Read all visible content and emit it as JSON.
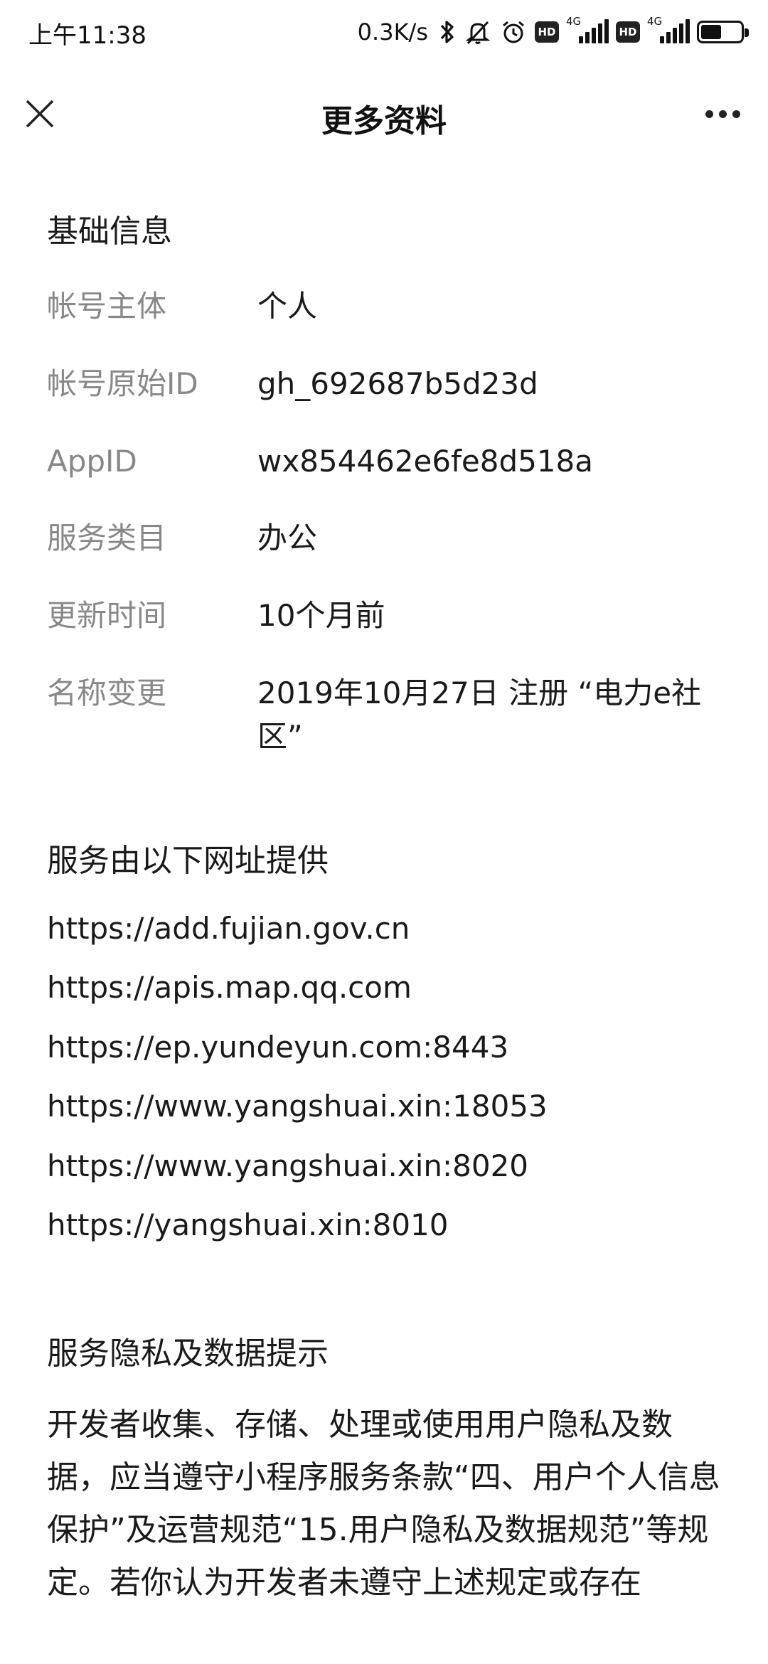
{
  "status_bar": {
    "time": "上午11:38",
    "network_speed": "0.3K/s",
    "hd_badge_1": "HD",
    "hd_badge_2": "HD",
    "signal_1_tag": "4G",
    "signal_2_tag": "4G",
    "icons": [
      "bluetooth-icon",
      "mute-icon",
      "alarm-icon",
      "signal-icon",
      "battery-icon"
    ]
  },
  "nav": {
    "title": "更多资料",
    "close_icon": "close-icon",
    "more_icon": "more-icon"
  },
  "basic_info": {
    "title": "基础信息",
    "rows": [
      {
        "label": "帐号主体",
        "value": "个人"
      },
      {
        "label": "帐号原始ID",
        "value": "gh_692687b5d23d"
      },
      {
        "label": "AppID",
        "value": "wx854462e6fe8d518a"
      },
      {
        "label": "服务类目",
        "value": "办公"
      },
      {
        "label": "更新时间",
        "value": "10个月前"
      },
      {
        "label": "名称变更",
        "value": "2019年10月27日 注册 “电力e社区”"
      }
    ]
  },
  "service_urls": {
    "title": "服务由以下网址提供",
    "items": [
      "https://add.fujian.gov.cn",
      "https://apis.map.qq.com",
      "https://ep.yundeyun.com:8443",
      "https://www.yangshuai.xin:18053",
      "https://www.yangshuai.xin:8020",
      "https://yangshuai.xin:8010"
    ]
  },
  "privacy": {
    "title": "服务隐私及数据提示",
    "text": "开发者收集、存储、处理或使用用户隐私及数据，应当遵守小程序服务条款“四、用户个人信息保护”及运营规范“15.用户隐私及数据规范”等规定。若你认为开发者未遵守上述规定或存在"
  }
}
